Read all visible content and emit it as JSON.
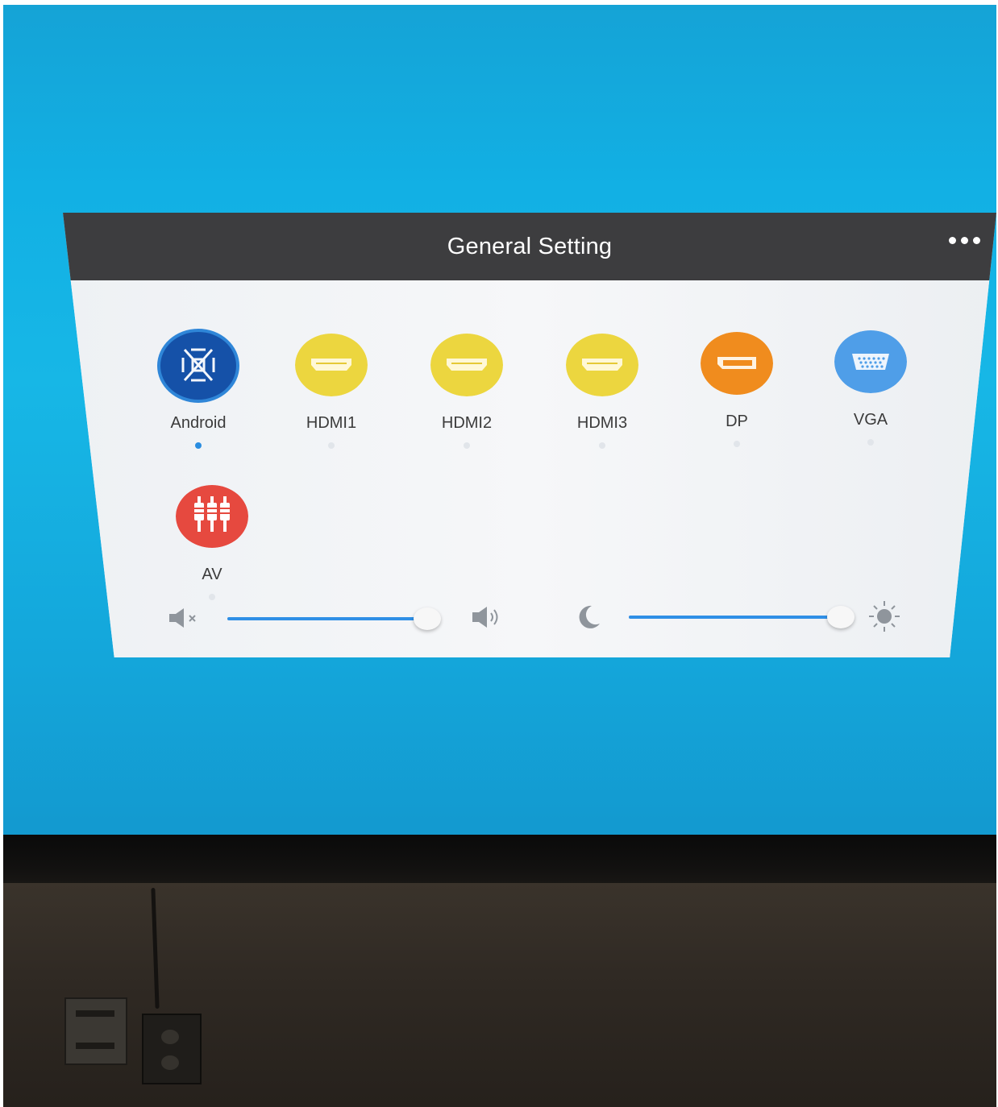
{
  "dialog": {
    "title": "General Setting",
    "more_icon": "more-horizontal-icon"
  },
  "sources": [
    {
      "label": "Android",
      "icon": "android-source-icon",
      "color": "#1551a8",
      "selected": true
    },
    {
      "label": "HDMI1",
      "icon": "hdmi-icon",
      "color": "#ecd63f",
      "selected": false
    },
    {
      "label": "HDMI2",
      "icon": "hdmi-icon",
      "color": "#ecd63f",
      "selected": false
    },
    {
      "label": "HDMI3",
      "icon": "hdmi-icon",
      "color": "#ecd63f",
      "selected": false
    },
    {
      "label": "DP",
      "icon": "displayport-icon",
      "color": "#f08c1e",
      "selected": false
    },
    {
      "label": "VGA",
      "icon": "vga-icon",
      "color": "#4f9ee8",
      "selected": false
    },
    {
      "label": "AV",
      "icon": "av-rca-icon",
      "color": "#e6493f",
      "selected": false
    }
  ],
  "controls": {
    "volume": {
      "min_icon": "volume-mute-icon",
      "max_icon": "volume-up-icon",
      "value_fraction": 0.96
    },
    "brightness": {
      "min_icon": "moon-icon",
      "max_icon": "sun-icon",
      "value_fraction": 0.98
    }
  },
  "colors": {
    "accent": "#2f8fe6",
    "titlebar": "#3d3d3f",
    "screen_background": "#14b0e3"
  }
}
